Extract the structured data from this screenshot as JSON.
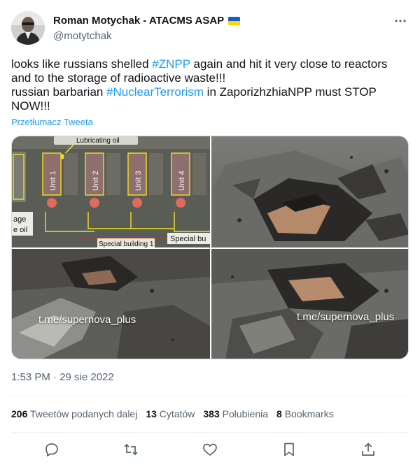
{
  "tweet": {
    "author_name": "Roman Motychak - ATACMS ASAP",
    "handle": "@motytchak",
    "flag_icon": "ukraine-flag-icon",
    "text": {
      "l1_pre": "looks like russians shelled ",
      "l1_tag": "#ZNPP",
      "l1_post": " again and hit it very close to reactors",
      "l2": "and to the storage of radioactive waste!!!",
      "l3_pre": "russian barbarian ",
      "l3_tag": "#NuclearTerrorism",
      "l3_post": " in ZaporizhzhiaNPP must STOP",
      "l4": "NOW!!!"
    },
    "translate_label": "Przetłumacz Tweeta",
    "timestamp": "1:53 PM · 29 sie 2022"
  },
  "media": {
    "image1": {
      "lubricating_label": "Lubricating oil",
      "units": [
        "Unit 1",
        "Unit 2",
        "Unit 3",
        "Unit 4"
      ],
      "left_frag": "age",
      "left_frag2": "e oil",
      "special1": "Special building 1",
      "special2": "Special bu"
    },
    "watermark_1": "t.me/supernova_plus",
    "watermark_2": "t.me/supernova_plus"
  },
  "stats": {
    "retweets_count": "206",
    "retweets_label": "Tweetów podanych dalej",
    "quotes_count": "13",
    "quotes_label": "Cytatów",
    "likes_count": "383",
    "likes_label": "Polubienia",
    "bookmarks_count": "8",
    "bookmarks_label": "Bookmarks"
  },
  "colors": {
    "accent": "#1d9bf0",
    "text_primary": "#0f1419",
    "text_secondary": "#536471"
  },
  "actions": [
    "reply-icon",
    "retweet-icon",
    "like-icon",
    "bookmark-icon",
    "share-icon"
  ]
}
